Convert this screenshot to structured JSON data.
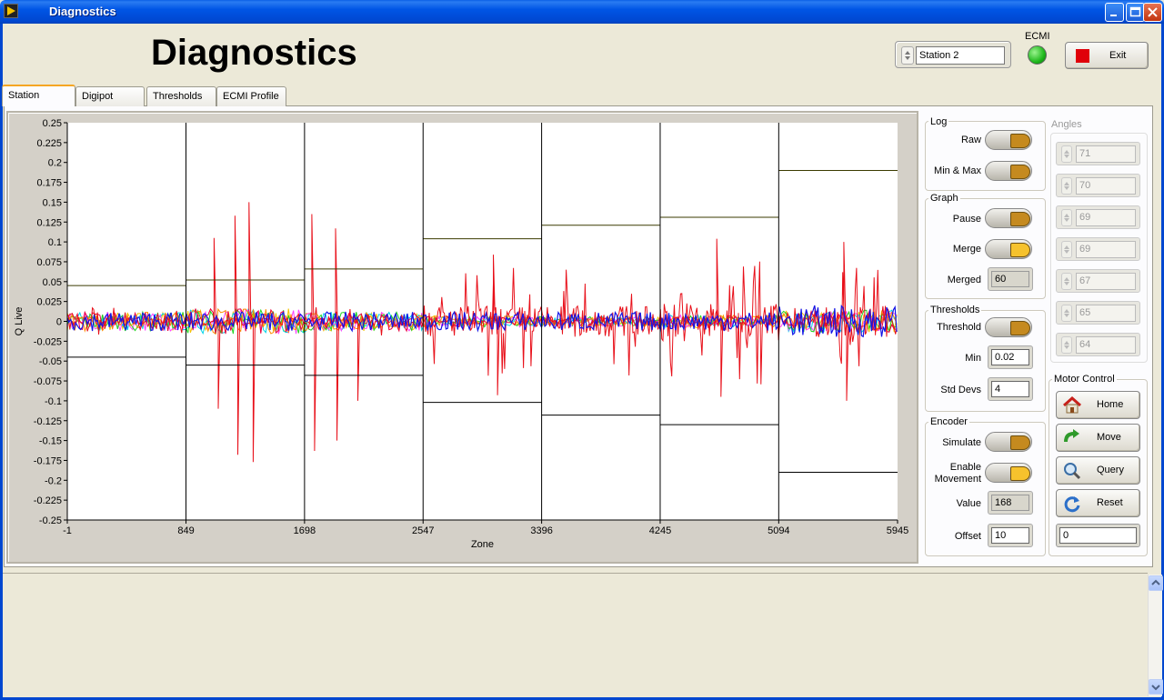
{
  "window": {
    "title": "Diagnostics"
  },
  "header": {
    "title": "Diagnostics",
    "station_value": "Station 2",
    "ecmi_label": "ECMI",
    "exit_label": "Exit"
  },
  "tabs": [
    {
      "label": "Station",
      "active": true
    },
    {
      "label": "Digipot",
      "active": false
    },
    {
      "label": "Thresholds",
      "active": false
    },
    {
      "label": "ECMI Profile",
      "active": false
    }
  ],
  "log": {
    "title": "Log",
    "raw_label": "Raw",
    "minmax_label": "Min & Max"
  },
  "graph": {
    "title": "Graph",
    "pause_label": "Pause",
    "merge_label": "Merge",
    "merged_label": "Merged",
    "merged_value": "60"
  },
  "thresholds": {
    "title": "Thresholds",
    "threshold_label": "Threshold",
    "min_label": "Min",
    "min_value": "0.02",
    "stddevs_label": "Std Devs",
    "stddevs_value": "4"
  },
  "encoder": {
    "title": "Encoder",
    "simulate_label": "Simulate",
    "enable_label_1": "Enable",
    "enable_label_2": "Movement",
    "value_label": "Value",
    "value": "168",
    "offset_label": "Offset",
    "offset_value": "10"
  },
  "angles": {
    "title": "Angles",
    "values": [
      "71",
      "70",
      "69",
      "69",
      "67",
      "65",
      "64"
    ]
  },
  "motor": {
    "title": "Motor Control",
    "home_label": "Home",
    "move_label": "Move",
    "query_label": "Query",
    "reset_label": "Reset",
    "value": "0"
  },
  "colors": {
    "accent_red": "#e0000a",
    "led_green": "#1fb81c",
    "toggle_off": "#c58a1f",
    "toggle_on": "#f6c22d"
  },
  "chart_data": {
    "type": "line",
    "xlabel": "Zone",
    "ylabel": "Q Live",
    "xlim": [
      -1,
      5945
    ],
    "ylim": [
      -0.25,
      0.25
    ],
    "x_ticks": [
      "-1",
      "849",
      "1698",
      "2547",
      "3396",
      "4245",
      "5094",
      "5945"
    ],
    "y_ticks": [
      "0.25",
      "0.225",
      "0.2",
      "0.175",
      "0.15",
      "0.125",
      "0.1",
      "0.075",
      "0.05",
      "0.025",
      "0",
      "-0.025",
      "-0.05",
      "-0.075",
      "-0.1",
      "-0.125",
      "-0.15",
      "-0.175",
      "-0.2",
      "-0.225",
      "-0.25"
    ],
    "zone_boundaries": [
      849,
      1698,
      2547,
      3396,
      4245,
      5094
    ],
    "upper_thresholds": [
      0.045,
      0.052,
      0.066,
      0.104,
      0.121,
      0.131,
      0.19
    ],
    "lower_thresholds": [
      -0.045,
      -0.055,
      -0.068,
      -0.102,
      -0.118,
      -0.13,
      -0.19
    ],
    "red_peaks": [
      {
        "x": 1200,
        "y": 0.133
      },
      {
        "x": 1300,
        "y": 0.15
      },
      {
        "x": 1330,
        "y": -0.177
      },
      {
        "x": 1050,
        "y": 0.105
      },
      {
        "x": 1080,
        "y": -0.11
      },
      {
        "x": 1220,
        "y": -0.168
      },
      {
        "x": 1750,
        "y": 0.135
      },
      {
        "x": 1770,
        "y": -0.163
      },
      {
        "x": 1920,
        "y": 0.117
      },
      {
        "x": 1930,
        "y": -0.15
      },
      {
        "x": 2080,
        "y": -0.1
      },
      {
        "x": 3050,
        "y": 0.084
      },
      {
        "x": 3080,
        "y": -0.093
      },
      {
        "x": 4650,
        "y": 0.104
      },
      {
        "x": 4680,
        "y": -0.095
      },
      {
        "x": 5560,
        "y": 0.1
      },
      {
        "x": 5580,
        "y": -0.1
      }
    ]
  }
}
